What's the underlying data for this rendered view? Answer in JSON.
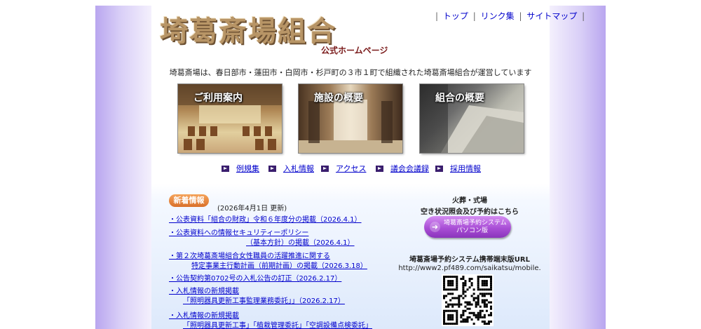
{
  "header": {
    "logo_title": "埼葛斎場組合",
    "logo_subtitle": "公式ホームページ"
  },
  "topnav": {
    "items": [
      "トップ",
      "リンク集",
      "サイトマップ"
    ]
  },
  "intro": "埼葛斎場は、春日部市・蓮田市・白岡市・杉戸町の３市１町で組織された埼葛斎場組合が運営しています",
  "banners": [
    {
      "label": "ご利用案内"
    },
    {
      "label": "施設の概要"
    },
    {
      "label": "組合の概要"
    }
  ],
  "sublinks": [
    "例規集",
    "入札情報",
    "アクセス",
    "議会会議録",
    "採用情報"
  ],
  "news": {
    "badge": "新着情報",
    "updated": "(2026年4月1日 更新)",
    "items": [
      {
        "l1": "・公表資料「組合の財政」令和６年度分の掲載（2026.4.1）"
      },
      {
        "l1": "・公表資料への情報セキュリティーポリシー",
        "l2": "（基本方針）の掲載（2026.4.1）"
      },
      {
        "l1": "・第２次埼葛斎場組合女性職員の活躍推進に関する",
        "l2": "特定事業主行動計画（前期計画）の掲載（2026.3.18）"
      },
      {
        "l1": "・公告契約第0702号の入札公告の訂正（2026.2.17）"
      },
      {
        "l1": "・入札情報の新規掲載",
        "l2": "「照明器具更新工事監理業務委託」」（2026.2.17）"
      },
      {
        "l1": "・入札情報の新規掲載",
        "l2": "「照明器具更新工事」「植栽管理委託」「空調設備点検委託」"
      }
    ]
  },
  "reservation": {
    "line1": "火葬・式場",
    "line2": "空き状況照会及び予約はこちら",
    "button_l1": "埼葛斎場予約システム",
    "button_l2": "パソコン版",
    "mobile_title": "埼葛斎場予約システム携帯端末版URL",
    "mobile_url": "http://www2.pf489.com/saikatsu/mobile."
  },
  "colors": {
    "side_purple": "#b9a6ef",
    "link_blue": "#0000cc",
    "badge_orange": "#d9702a",
    "button_purple": "#a94fd6",
    "logo_brown": "#b89566",
    "subtitle_red": "#7a1a1a"
  },
  "icons": {
    "bullet": "play-square-icon",
    "reservation_arrow": "arrow-right-circle-icon",
    "qr": "qr-code-icon"
  }
}
